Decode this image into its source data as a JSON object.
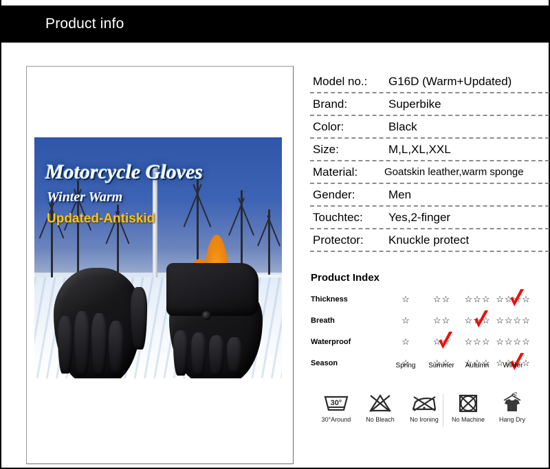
{
  "header": {
    "title": "Product info"
  },
  "product_image": {
    "title": "Motorcycle Gloves",
    "subtitle": "Winter Warm",
    "tagline": "Updated-Antiskid",
    "scene_description": "black leather motorcycle gloves on snow with fire and winter forest"
  },
  "specs": [
    {
      "key": "Model no.:",
      "value": "G16D  (Warm+Updated)"
    },
    {
      "key": "Brand:",
      "value": "Superbike"
    },
    {
      "key": "Color:",
      "value": "Black"
    },
    {
      "key": "Size:",
      "value": "M,L,XL,XXL"
    },
    {
      "key": "Material:",
      "value": "Goatskin leather,warm sponge"
    },
    {
      "key": "Gender:",
      "value": "Men"
    },
    {
      "key": "Touchtec:",
      "value": "Yes,2-finger"
    },
    {
      "key": "Protector:",
      "value": "Knuckle protect"
    }
  ],
  "product_index": {
    "title": "Product Index",
    "columns": [
      {
        "stars": 1,
        "season": "Spring"
      },
      {
        "stars": 2,
        "season": "Summer"
      },
      {
        "stars": 3,
        "season": "Autumn"
      },
      {
        "stars": 4,
        "season": "Winter"
      }
    ],
    "rows": [
      {
        "label": "Thickness",
        "selected_column": 4,
        "rating": 4
      },
      {
        "label": "Breath",
        "selected_column": 3,
        "rating": 3
      },
      {
        "label": "Waterproof",
        "selected_column": 2,
        "rating": 2
      },
      {
        "label": "Season",
        "selected_column": 4,
        "rating": 4
      }
    ],
    "check_color": "#e8120c",
    "star_glyph": "☆"
  },
  "care_instructions": [
    {
      "icon": "wash-30-icon",
      "label": "30°Around",
      "temp": "30°"
    },
    {
      "icon": "no-bleach-icon",
      "label": "No Bleach"
    },
    {
      "icon": "no-ironing-icon",
      "label": "No Ironing"
    },
    {
      "icon": "no-machine-icon",
      "label": "No Machine"
    },
    {
      "icon": "hang-dry-icon",
      "label": "Hang Dry",
      "badge": "2"
    }
  ],
  "colors": {
    "header_bg": "#000000",
    "header_text": "#ffffff",
    "accent_red": "#e8120c",
    "tagline_yellow": "#f3c51b",
    "dashed_rule": "#8c8c8c"
  }
}
